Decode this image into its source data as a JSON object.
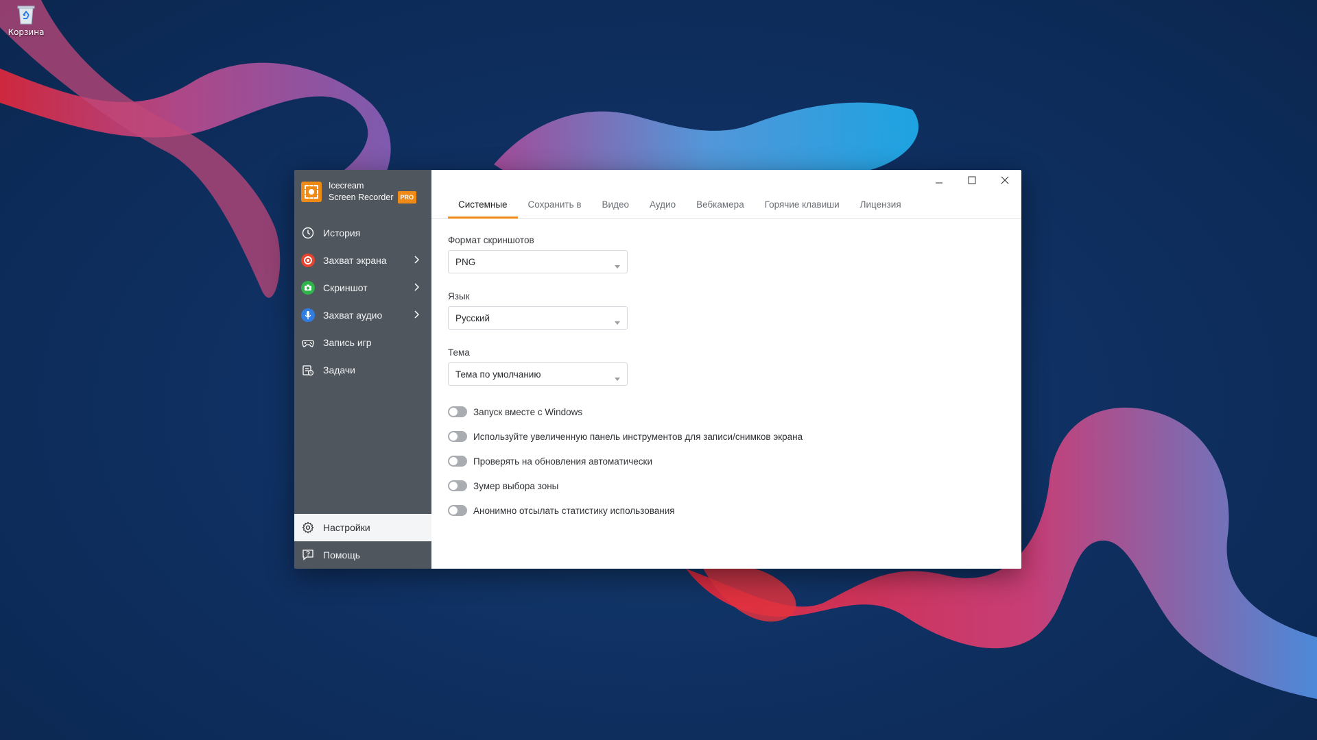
{
  "desktop": {
    "recycle_bin_label": "Корзина"
  },
  "app": {
    "brand_line1": "Icecream",
    "brand_line2": "Screen Recorder",
    "pro_badge": "PRO",
    "accent_color": "#f08a16"
  },
  "sidebar": {
    "items": [
      {
        "label": "История",
        "icon": "clock-icon"
      },
      {
        "label": "Захват экрана",
        "icon": "record-icon",
        "icon_color": "#e8432e"
      },
      {
        "label": "Скриншот",
        "icon": "camera-icon",
        "icon_color": "#2fb44b"
      },
      {
        "label": "Захват аудио",
        "icon": "microphone-icon",
        "icon_color": "#2f7de1"
      },
      {
        "label": "Запись игр",
        "icon": "gamepad-icon"
      },
      {
        "label": "Задачи",
        "icon": "tasks-icon"
      }
    ],
    "bottom": [
      {
        "label": "Настройки",
        "icon": "gear-icon"
      },
      {
        "label": "Помощь",
        "icon": "help-icon"
      }
    ]
  },
  "tabs": [
    "Системные",
    "Сохранить в",
    "Видео",
    "Аудио",
    "Вебкамера",
    "Горячие клавиши",
    "Лицензия"
  ],
  "settings": {
    "screenshot_format_label": "Формат скриншотов",
    "screenshot_format_value": "PNG",
    "language_label": "Язык",
    "language_value": "Русский",
    "theme_label": "Тема",
    "theme_value": "Тема по умолчанию",
    "toggles": [
      {
        "label": "Запуск вместе с Windows",
        "on": false
      },
      {
        "label": "Используйте увеличенную панель инструментов для записи/снимков экрана",
        "on": false
      },
      {
        "label": "Проверять на обновления автоматически",
        "on": false
      },
      {
        "label": "Зумер выбора зоны",
        "on": false
      },
      {
        "label": "Анонимно отсылать статистику использования",
        "on": false
      }
    ]
  }
}
